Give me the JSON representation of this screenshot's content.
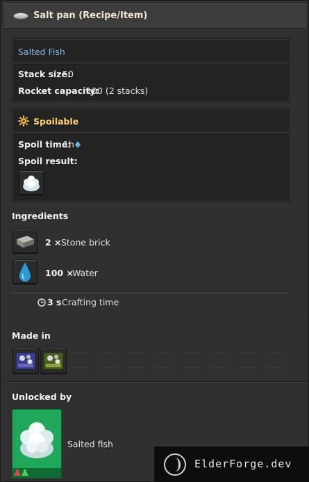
{
  "window": {
    "title": "Salt pan (Recipe/Item)",
    "title_icon": "salt-pan-icon"
  },
  "item_panel": {
    "name": "Salted Fish",
    "stack_size_label": "Stack size:",
    "stack_size_value": "50",
    "rocket_capacity_label": "Rocket capacity:",
    "rocket_capacity_value": "100 (2 stacks)"
  },
  "spoil_panel": {
    "header": "Spoilable",
    "header_icon": "spoil-gear-icon",
    "spoil_time_label": "Spoil time:",
    "spoil_time_value": "1h",
    "spoil_result_label": "Spoil result:",
    "spoil_result_icon": "salt-crystal-icon"
  },
  "ingredients": {
    "header": "Ingredients",
    "items": [
      {
        "amount": "2 ×",
        "name": "Stone brick",
        "icon": "stone-brick-icon"
      },
      {
        "amount": "100 ×",
        "name": "Water",
        "icon": "water-drop-icon"
      }
    ],
    "time_value": "3 s",
    "time_label": "Crafting time"
  },
  "made_in": {
    "header": "Made in",
    "machines": [
      {
        "icon": "assembler-blue-icon"
      },
      {
        "icon": "assembler-green-icon"
      }
    ],
    "empty_slots": 8
  },
  "unlocked_by": {
    "header": "Unlocked by",
    "tech_name": "Salted fish",
    "tech_icon": "salted-fish-tech-icon"
  },
  "watermark": {
    "text": "ElderForge.dev"
  },
  "colors": {
    "link": "#7fb6e0",
    "accent_orange": "#ffcf6a",
    "tech_green": "#1fa85a"
  }
}
